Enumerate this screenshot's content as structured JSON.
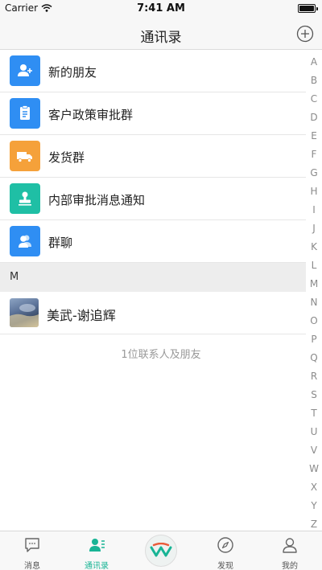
{
  "status_bar": {
    "carrier": "Carrier",
    "time": "7:41 AM"
  },
  "nav": {
    "title": "通讯录"
  },
  "groups": [
    {
      "label": "新的朋友",
      "icon": "person-add-icon",
      "color": "#2f8ef3"
    },
    {
      "label": "客户政策审批群",
      "icon": "document-icon",
      "color": "#2f8ef3"
    },
    {
      "label": "发货群",
      "icon": "truck-icon",
      "color": "#f5a13a"
    },
    {
      "label": "内部审批消息通知",
      "icon": "stamp-icon",
      "color": "#1fbfa5"
    },
    {
      "label": "群聊",
      "icon": "group-icon",
      "color": "#2f8ef3"
    }
  ],
  "section": {
    "letter": "M"
  },
  "contacts": [
    {
      "name": "美武-谢追辉",
      "icon": "avatar-photo"
    }
  ],
  "footer": {
    "count_text": "1位联系人及朋友"
  },
  "index_letters": [
    "A",
    "B",
    "C",
    "D",
    "E",
    "F",
    "G",
    "H",
    "I",
    "J",
    "K",
    "L",
    "M",
    "N",
    "O",
    "P",
    "Q",
    "R",
    "S",
    "T",
    "U",
    "V",
    "W",
    "X",
    "Y",
    "Z"
  ],
  "tabs": [
    {
      "label": "消息",
      "icon": "message-icon",
      "active": false
    },
    {
      "label": "通讯录",
      "icon": "contacts-icon",
      "active": true
    },
    {
      "label": "",
      "icon": "app-logo-icon",
      "active": false
    },
    {
      "label": "发现",
      "icon": "compass-icon",
      "active": false
    },
    {
      "label": "我的",
      "icon": "profile-icon",
      "active": false
    }
  ],
  "colors": {
    "accent": "#18b495",
    "blue": "#2f8ef3",
    "orange": "#f5a13a",
    "teal": "#1fbfa5"
  }
}
